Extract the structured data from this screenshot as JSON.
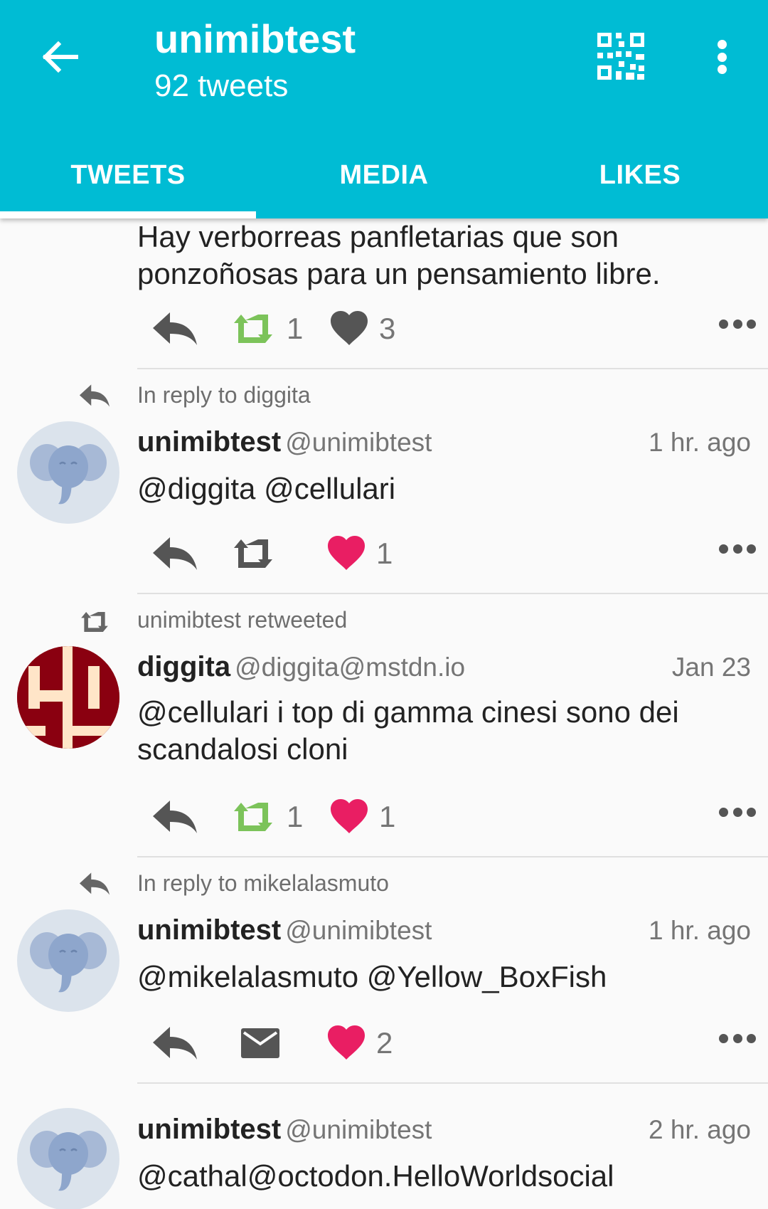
{
  "app_bar": {
    "title": "unimibtest",
    "subtitle": "92 tweets",
    "back_icon": "arrow-left-icon",
    "qr_icon": "qr-code-icon",
    "more_icon": "more-vertical-icon"
  },
  "tabs": [
    {
      "label": "TWEETS",
      "selected": true
    },
    {
      "label": "MEDIA",
      "selected": false
    },
    {
      "label": "LIKES",
      "selected": false
    }
  ],
  "colors": {
    "primary": "#00bcd4",
    "retweet_active": "#7cc35a",
    "like_active": "#e91e63",
    "icon_gray": "#555555"
  },
  "tweets": [
    {
      "body": "Hay verborreas panfletarias que son ponzoñosas para un pensamiento libre.",
      "retweet_count": "1",
      "like_count": "3",
      "retweeted": true,
      "liked": false
    },
    {
      "context": "In reply to diggita",
      "name": "unimibtest",
      "handle": "@unimibtest",
      "time": "1 hr. ago",
      "body": "@diggita @cellulari",
      "retweet_count": "",
      "like_count": "1",
      "liked": true
    },
    {
      "context": "unimibtest retweeted",
      "name": "diggita",
      "handle": "@diggita@mstdn.io",
      "time": "Jan 23",
      "body": "@cellulari i top di gamma cinesi sono dei scandalosi cloni",
      "retweet_count": "1",
      "like_count": "1",
      "retweeted": true,
      "liked": true
    },
    {
      "context": "In reply to mikelalasmuto",
      "name": "unimibtest",
      "handle": "@unimibtest",
      "time": "1 hr. ago",
      "body": "@mikelalasmuto @Yellow_BoxFish",
      "like_count": "2",
      "liked": true
    },
    {
      "name": "unimibtest",
      "handle": "@unimibtest",
      "time": "2 hr. ago",
      "body": "@cathal@octodon.HelloWorldsocial"
    }
  ]
}
